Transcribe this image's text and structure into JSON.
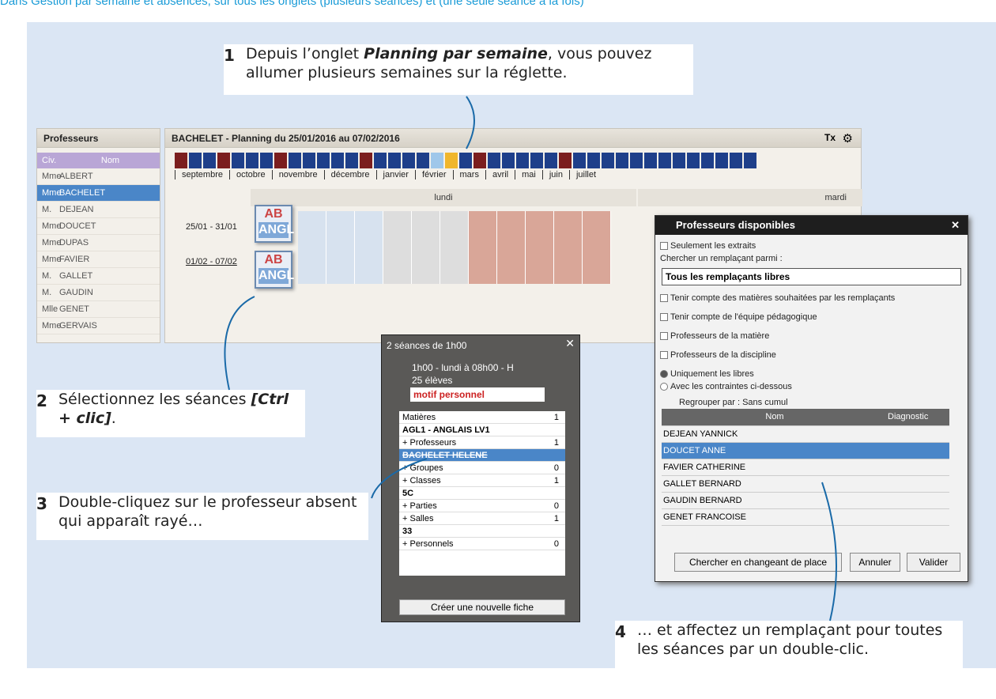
{
  "header_text": "Dans Gestion par semaine et absences, sur tous les onglets (plusieurs séances) et (une seule séance à la fois)",
  "callouts": [
    {
      "num": "1",
      "html": "Depuis l’onglet <b>Planning par semaine</b>, vous pouvez allumer plusieurs semaines sur la réglette."
    },
    {
      "num": "2",
      "html": "Sélectionnez les séances <b>[Ctrl + clic]</b>."
    },
    {
      "num": "3",
      "html": "Double-cliquez sur le professeur absent qui apparaît rayé…"
    },
    {
      "num": "4",
      "html": "… et affectez un remplaçant pour toutes les séances par un double-clic."
    }
  ],
  "profs": {
    "title": "Professeurs",
    "col_civ": "Civ.",
    "col_nom": "Nom",
    "rows": [
      [
        "Mme",
        "ALBERT"
      ],
      [
        "Mme",
        "BACHELET"
      ],
      [
        "M.",
        "DEJEAN"
      ],
      [
        "Mme",
        "DOUCET"
      ],
      [
        "Mme",
        "DUPAS"
      ],
      [
        "Mme",
        "FAVIER"
      ],
      [
        "M.",
        "GALLET"
      ],
      [
        "M.",
        "GAUDIN"
      ],
      [
        "Mlle",
        "GENET"
      ],
      [
        "Mme",
        "GERVAIS"
      ]
    ],
    "selected_index": 1
  },
  "planning": {
    "title": "BACHELET - Planning du 25/01/2016 au 07/02/2016",
    "months": [
      "septembre",
      "octobre",
      "novembre",
      "décembre",
      "janvier",
      "février",
      "mars",
      "avril",
      "mai",
      "juin",
      "juillet"
    ],
    "day1": "lundi",
    "day2": "mardi",
    "week1": "25/01 - 31/01",
    "week2": "01/02 - 07/02",
    "ab_top": "AB",
    "ab_bottom": "ANGL"
  },
  "seances": {
    "title": "2 séances de 1h00",
    "line1": "1h00 - lundi à 08h00 - H",
    "line2": "25 élèves",
    "motif": "motif personnel",
    "rows": [
      [
        "Matières",
        "1",
        "",
        ""
      ],
      [
        "AGL1 - ANGLAIS LV1",
        "",
        "bold",
        ""
      ],
      [
        "+ Professeurs",
        "1",
        "",
        ""
      ],
      [
        "BACHELET HELENE",
        "",
        "strike",
        ""
      ],
      [
        "+ Groupes",
        "0",
        "",
        ""
      ],
      [
        "+ Classes",
        "1",
        "",
        ""
      ],
      [
        "5C",
        "",
        "bold",
        ""
      ],
      [
        "+ Parties",
        "0",
        "",
        ""
      ],
      [
        "+ Salles",
        "1",
        "",
        ""
      ],
      [
        "33",
        "",
        "bold",
        ""
      ],
      [
        "+ Personnels",
        "0",
        "",
        ""
      ]
    ],
    "create": "Créer une nouvelle fiche"
  },
  "dialog": {
    "title": "Professeurs disponibles",
    "opt1": "Seulement les extraits",
    "search_label": "Chercher un remplaçant parmi :",
    "select_value": "Tous les remplaçants libres",
    "checks": [
      "Tenir compte des matières souhaitées par les remplaçants",
      "Tenir compte de l'équipe pédagogique",
      "Professeurs de la matière",
      "Professeurs de la discipline"
    ],
    "radio1": "Uniquement les libres",
    "radio2": "Avec les contraintes ci-dessous",
    "group": "Regrouper par : Sans cumul",
    "col_nom": "Nom",
    "col_diag": "Diagnostic",
    "list": [
      "DEJEAN YANNICK",
      "DOUCET ANNE",
      "FAVIER CATHERINE",
      "GALLET BERNARD",
      "GAUDIN BERNARD",
      "GENET FRANCOISE"
    ],
    "selected": 1,
    "btn_search": "Chercher en changeant de place",
    "btn_cancel": "Annuler",
    "btn_ok": "Valider"
  },
  "colors": {
    "accent": "#4a86c8",
    "panel": "#dbe6f4",
    "week_dark": "#1e3f8a",
    "week_red": "#7b1e1e"
  }
}
